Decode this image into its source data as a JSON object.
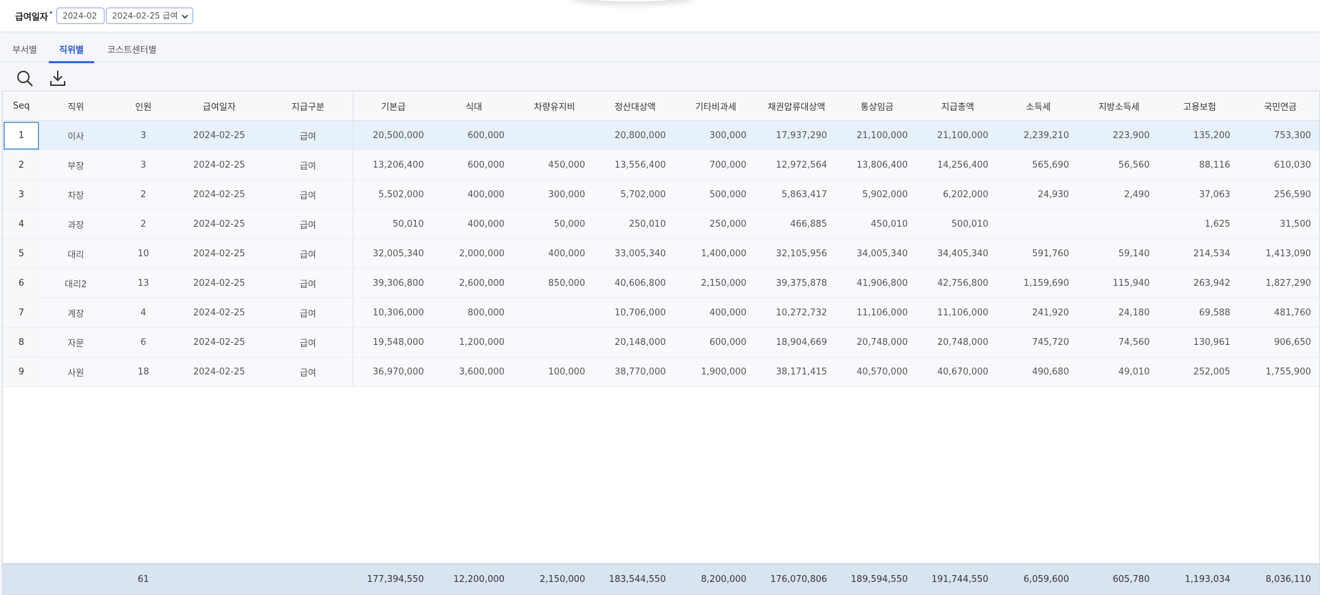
{
  "filter": {
    "label": "급여일자",
    "required_mark": "•",
    "month": "2024-02",
    "date": "2024-02-25 급여"
  },
  "tabs": [
    {
      "label": "부서별",
      "active": false
    },
    {
      "label": "직위별",
      "active": true
    },
    {
      "label": "코스트센터별",
      "active": false
    }
  ],
  "toolbar": {
    "search_icon": "search-icon",
    "download_icon": "download-icon"
  },
  "colors": {
    "accent": "#3464d4",
    "selected_row": "#e6f1fa",
    "footer": "#d9e4f1"
  },
  "grid": {
    "columns": [
      "Seq",
      "직위",
      "인원",
      "급여일자",
      "지급구분",
      "기본급",
      "식대",
      "차량유지비",
      "정산대상액",
      "기타비과세",
      "채권압류대상액",
      "통상임금",
      "지급총액",
      "소득세",
      "지방소득세",
      "고용보험",
      "국민연금"
    ],
    "rows": [
      [
        "1",
        "이사",
        "3",
        "2024-02-25",
        "급여",
        "20,500,000",
        "600,000",
        "",
        "20,800,000",
        "300,000",
        "17,937,290",
        "21,100,000",
        "21,100,000",
        "2,239,210",
        "223,900",
        "135,200",
        "753,300"
      ],
      [
        "2",
        "부장",
        "3",
        "2024-02-25",
        "급여",
        "13,206,400",
        "600,000",
        "450,000",
        "13,556,400",
        "700,000",
        "12,972,564",
        "13,806,400",
        "14,256,400",
        "565,690",
        "56,560",
        "88,116",
        "610,030"
      ],
      [
        "3",
        "차장",
        "2",
        "2024-02-25",
        "급여",
        "5,502,000",
        "400,000",
        "300,000",
        "5,702,000",
        "500,000",
        "5,863,417",
        "5,902,000",
        "6,202,000",
        "24,930",
        "2,490",
        "37,063",
        "256,590"
      ],
      [
        "4",
        "과장",
        "2",
        "2024-02-25",
        "급여",
        "50,010",
        "400,000",
        "50,000",
        "250,010",
        "250,000",
        "466,885",
        "450,010",
        "500,010",
        "",
        "",
        "1,625",
        "31,500"
      ],
      [
        "5",
        "대리",
        "10",
        "2024-02-25",
        "급여",
        "32,005,340",
        "2,000,000",
        "400,000",
        "33,005,340",
        "1,400,000",
        "32,105,956",
        "34,005,340",
        "34,405,340",
        "591,760",
        "59,140",
        "214,534",
        "1,413,090"
      ],
      [
        "6",
        "대리2",
        "13",
        "2024-02-25",
        "급여",
        "39,306,800",
        "2,600,000",
        "850,000",
        "40,606,800",
        "2,150,000",
        "39,375,878",
        "41,906,800",
        "42,756,800",
        "1,159,690",
        "115,940",
        "263,942",
        "1,827,290"
      ],
      [
        "7",
        "계장",
        "4",
        "2024-02-25",
        "급여",
        "10,306,000",
        "800,000",
        "",
        "10,706,000",
        "400,000",
        "10,272,732",
        "11,106,000",
        "11,106,000",
        "241,920",
        "24,180",
        "69,588",
        "481,760"
      ],
      [
        "8",
        "자문",
        "6",
        "2024-02-25",
        "급여",
        "19,548,000",
        "1,200,000",
        "",
        "20,148,000",
        "600,000",
        "18,904,669",
        "20,748,000",
        "20,748,000",
        "745,720",
        "74,560",
        "130,961",
        "906,650"
      ],
      [
        "9",
        "사원",
        "18",
        "2024-02-25",
        "급여",
        "36,970,000",
        "3,600,000",
        "100,000",
        "38,770,000",
        "1,900,000",
        "38,171,415",
        "40,570,000",
        "40,670,000",
        "490,680",
        "49,010",
        "252,005",
        "1,755,900"
      ]
    ],
    "selected_row": 0,
    "totals": [
      "",
      "",
      "61",
      "",
      "",
      "177,394,550",
      "12,200,000",
      "2,150,000",
      "183,544,550",
      "8,200,000",
      "176,070,806",
      "189,594,550",
      "191,744,550",
      "6,059,600",
      "605,780",
      "1,193,034",
      "8,036,110"
    ]
  }
}
